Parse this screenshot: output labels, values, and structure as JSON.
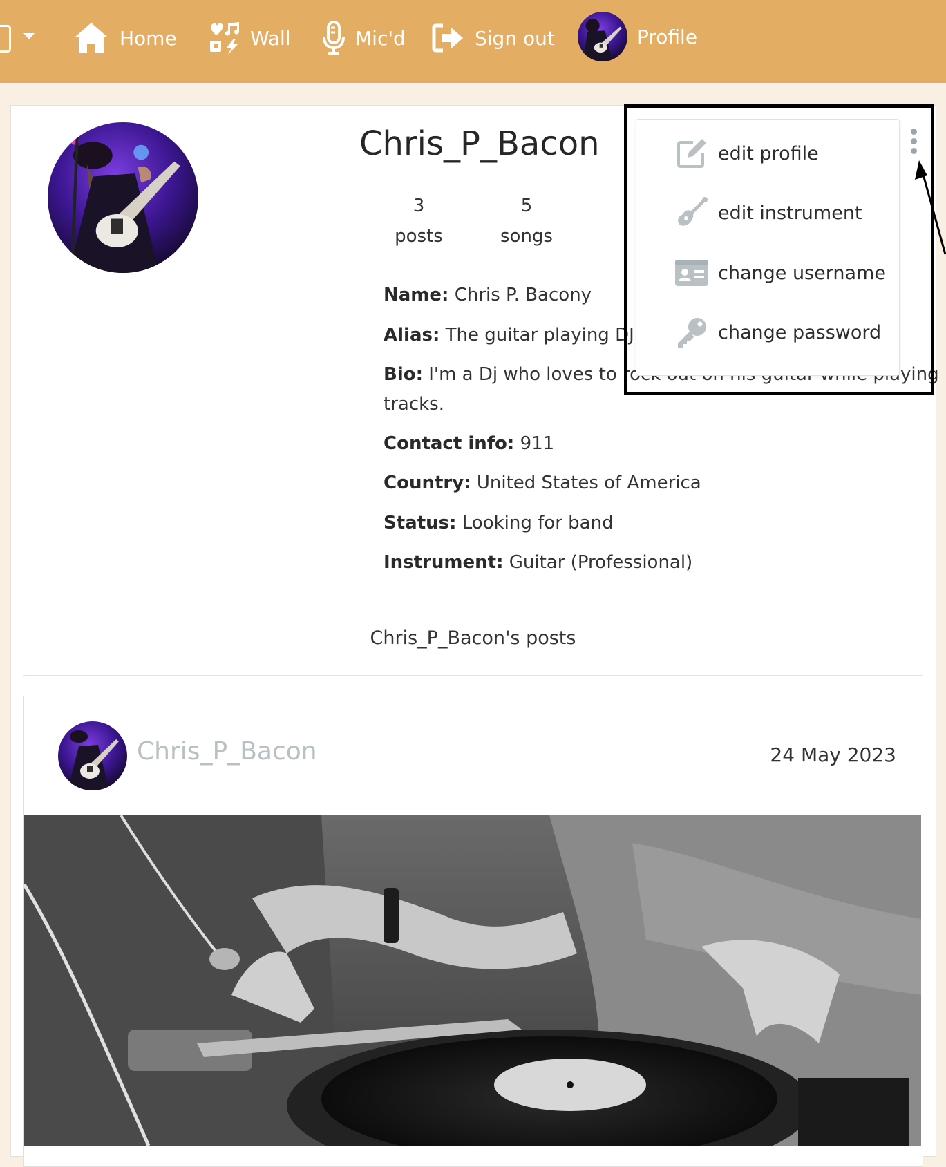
{
  "nav": {
    "items": [
      {
        "label": "Home",
        "icon": "home-icon"
      },
      {
        "label": "Wall",
        "icon": "music-shapes-icon"
      },
      {
        "label": "Mic'd",
        "icon": "microphone-icon"
      },
      {
        "label": "Sign out",
        "icon": "sign-out-icon"
      },
      {
        "label": "Profile",
        "icon": "avatar"
      }
    ]
  },
  "profile": {
    "username": "Chris_P_Bacon",
    "stats": [
      {
        "count": "3",
        "label": "posts"
      },
      {
        "count": "5",
        "label": "songs"
      }
    ],
    "details": [
      {
        "label": "Name:",
        "value": "Chris P. Bacony"
      },
      {
        "label": "Alias:",
        "value": "The guitar playing DJ"
      },
      {
        "label": "Bio:",
        "value": "I'm a Dj who loves to rock out on his guitar while playing",
        "value_cont": "tracks."
      },
      {
        "label": "Contact info:",
        "value": "911"
      },
      {
        "label": "Country:",
        "value": "United States of America"
      },
      {
        "label": "Status:",
        "value": "Looking for band"
      },
      {
        "label": "Instrument:",
        "value": "Guitar (Professional)"
      }
    ],
    "posts_heading": "Chris_P_Bacon's posts"
  },
  "menu": {
    "items": [
      {
        "label": "edit profile",
        "icon": "edit-icon"
      },
      {
        "label": "edit instrument",
        "icon": "guitar-icon"
      },
      {
        "label": "change username",
        "icon": "id-card-icon"
      },
      {
        "label": "change password",
        "icon": "key-icon"
      }
    ]
  },
  "post": {
    "author": "Chris_P_Bacon",
    "date": "24 May 2023"
  },
  "colors": {
    "navbar": "#e3ad63",
    "background": "#f9efe3",
    "muted_author": "#b8c0c3",
    "highlight_border": "#000000"
  }
}
